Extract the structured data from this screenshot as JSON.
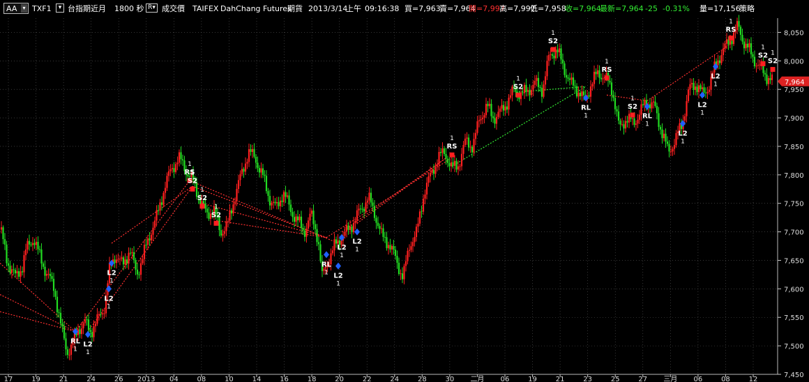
{
  "toolbar": {
    "aa_label": "AA",
    "symbol": "TXF1",
    "product_name": "台指期近月",
    "interval": "1800 秒",
    "field": "成交價",
    "exchange": "TAIFEX",
    "broker": "DahChang Futures",
    "market": "期貨",
    "date": "2013/3/14",
    "session": "上午",
    "time": "09:16:38",
    "bid": "買=7,963",
    "ask": "賣=7,964",
    "open": "開=7,997",
    "high": "高=7,997",
    "low": "低=7,958",
    "close": "收=7,964",
    "last": "最新=7,964",
    "change": "-25",
    "change_pct": "-0.31%",
    "volume": "量=17,156",
    "strategy": "策略"
  },
  "colors": {
    "background": "#000000",
    "grid": "#5a5a5a",
    "up_bar": "#ff2020",
    "down_bar": "#22dd22",
    "buy_marker": "#2060ff",
    "sell_marker": "#ff2020",
    "sell_link_line": "#ff3030",
    "buy_link_line": "#33ee33",
    "open_text": "#ff3030",
    "change_text": "#33ee33",
    "price_tag": "#dd2222"
  },
  "chart_data": {
    "type": "candlestick",
    "ylim": [
      7450,
      8075
    ],
    "y_ticks": [
      7450,
      7500,
      7550,
      7600,
      7650,
      7700,
      7750,
      7800,
      7850,
      7900,
      7950,
      8000,
      8050
    ],
    "y_tick_labels": [
      "7,450",
      "7,500",
      "7,550",
      "7,600",
      "7,650",
      "7,700",
      "7,750",
      "7,800",
      "7,850",
      "7,900",
      "7,950",
      "8,000",
      "8,050"
    ],
    "x_tick_labels": [
      "17",
      "19",
      "21",
      "24",
      "26",
      "2013",
      "04",
      "08",
      "10",
      "14",
      "16",
      "18",
      "20",
      "22",
      "24",
      "28",
      "30",
      "二月",
      "06",
      "19",
      "21",
      "23",
      "25",
      "27",
      "三月",
      "06",
      "08",
      "12"
    ],
    "current_price": 7964,
    "current_price_label": "7,964",
    "path": [
      [
        0,
        7710
      ],
      [
        10,
        7650
      ],
      [
        22,
        7620
      ],
      [
        32,
        7640
      ],
      [
        38,
        7670
      ],
      [
        48,
        7690
      ],
      [
        56,
        7660
      ],
      [
        66,
        7630
      ],
      [
        78,
        7600
      ],
      [
        88,
        7530
      ],
      [
        96,
        7490
      ],
      [
        104,
        7500
      ],
      [
        112,
        7530
      ],
      [
        122,
        7540
      ],
      [
        130,
        7525
      ],
      [
        140,
        7545
      ],
      [
        150,
        7570
      ],
      [
        158,
        7640
      ],
      [
        166,
        7660
      ],
      [
        176,
        7640
      ],
      [
        186,
        7670
      ],
      [
        196,
        7625
      ],
      [
        206,
        7660
      ],
      [
        216,
        7700
      ],
      [
        226,
        7730
      ],
      [
        236,
        7780
      ],
      [
        246,
        7810
      ],
      [
        256,
        7830
      ],
      [
        266,
        7810
      ],
      [
        276,
        7790
      ],
      [
        286,
        7760
      ],
      [
        296,
        7730
      ],
      [
        306,
        7740
      ],
      [
        316,
        7700
      ],
      [
        326,
        7710
      ],
      [
        336,
        7760
      ],
      [
        346,
        7800
      ],
      [
        356,
        7840
      ],
      [
        366,
        7830
      ],
      [
        376,
        7800
      ],
      [
        386,
        7760
      ],
      [
        396,
        7740
      ],
      [
        406,
        7770
      ],
      [
        416,
        7740
      ],
      [
        426,
        7720
      ],
      [
        436,
        7700
      ],
      [
        446,
        7730
      ],
      [
        456,
        7690
      ],
      [
        462,
        7620
      ],
      [
        470,
        7650
      ],
      [
        478,
        7670
      ],
      [
        488,
        7690
      ],
      [
        498,
        7700
      ],
      [
        508,
        7720
      ],
      [
        518,
        7740
      ],
      [
        528,
        7760
      ],
      [
        538,
        7730
      ],
      [
        548,
        7690
      ],
      [
        558,
        7680
      ],
      [
        568,
        7650
      ],
      [
        578,
        7620
      ],
      [
        588,
        7680
      ],
      [
        598,
        7700
      ],
      [
        608,
        7770
      ],
      [
        618,
        7800
      ],
      [
        628,
        7830
      ],
      [
        638,
        7840
      ],
      [
        648,
        7810
      ],
      [
        658,
        7820
      ],
      [
        668,
        7860
      ],
      [
        678,
        7850
      ],
      [
        688,
        7900
      ],
      [
        698,
        7920
      ],
      [
        708,
        7900
      ],
      [
        718,
        7910
      ],
      [
        728,
        7930
      ],
      [
        738,
        7950
      ],
      [
        748,
        7940
      ],
      [
        758,
        7950
      ],
      [
        768,
        7960
      ],
      [
        778,
        7950
      ],
      [
        788,
        8010
      ],
      [
        798,
        8020
      ],
      [
        808,
        7990
      ],
      [
        818,
        7960
      ],
      [
        828,
        7950
      ],
      [
        838,
        7930
      ],
      [
        848,
        7960
      ],
      [
        858,
        7980
      ],
      [
        868,
        7970
      ],
      [
        878,
        7950
      ],
      [
        888,
        7880
      ],
      [
        898,
        7900
      ],
      [
        908,
        7890
      ],
      [
        918,
        7910
      ],
      [
        928,
        7930
      ],
      [
        938,
        7920
      ],
      [
        948,
        7880
      ],
      [
        958,
        7840
      ],
      [
        968,
        7860
      ],
      [
        978,
        7890
      ],
      [
        988,
        7950
      ],
      [
        998,
        7960
      ],
      [
        1008,
        7940
      ],
      [
        1018,
        7960
      ],
      [
        1028,
        8000
      ],
      [
        1038,
        8020
      ],
      [
        1048,
        8040
      ],
      [
        1058,
        8060
      ],
      [
        1068,
        8030
      ],
      [
        1078,
        8010
      ],
      [
        1088,
        7990
      ],
      [
        1098,
        7975
      ],
      [
        1108,
        7964
      ]
    ],
    "signals": [
      {
        "label": "RL",
        "count": "1",
        "side": "buy",
        "x": 108,
        "price": 7525
      },
      {
        "label": "L2",
        "count": "1",
        "side": "buy",
        "x": 126,
        "price": 7520
      },
      {
        "label": "L2",
        "count": "1",
        "side": "buy",
        "x": 156,
        "price": 7600
      },
      {
        "label": "L2",
        "count": "1",
        "side": "buy",
        "x": 160,
        "price": 7645
      },
      {
        "label": "RS",
        "count": "1",
        "side": "sell",
        "x": 272,
        "price": 7790
      },
      {
        "label": "S2",
        "count": "1",
        "side": "sell",
        "x": 276,
        "price": 7775
      },
      {
        "label": "S2",
        "count": "1",
        "side": "sell",
        "x": 290,
        "price": 7745
      },
      {
        "label": "S2",
        "count": "1",
        "side": "sell",
        "x": 310,
        "price": 7715
      },
      {
        "label": "RL",
        "count": "1",
        "side": "buy",
        "x": 468,
        "price": 7660
      },
      {
        "label": "L2",
        "count": "1",
        "side": "buy",
        "x": 485,
        "price": 7640
      },
      {
        "label": "L2",
        "count": "1",
        "side": "buy",
        "x": 490,
        "price": 7690
      },
      {
        "label": "L2",
        "count": "1",
        "side": "buy",
        "x": 512,
        "price": 7700
      },
      {
        "label": "RS",
        "count": "1",
        "side": "sell",
        "x": 648,
        "price": 7835
      },
      {
        "label": "S2",
        "count": "1",
        "side": "sell",
        "x": 743,
        "price": 7940
      },
      {
        "label": "S2",
        "count": "1",
        "side": "sell",
        "x": 793,
        "price": 8020
      },
      {
        "label": "RL",
        "count": "1",
        "side": "buy",
        "x": 840,
        "price": 7935
      },
      {
        "label": "RS",
        "count": "1",
        "side": "sell",
        "x": 870,
        "price": 7970
      },
      {
        "label": "S2",
        "count": "1",
        "side": "sell",
        "x": 907,
        "price": 7905
      },
      {
        "label": "RL",
        "count": "1",
        "side": "buy",
        "x": 928,
        "price": 7920
      },
      {
        "label": "L2",
        "count": "1",
        "side": "buy",
        "x": 979,
        "price": 7890
      },
      {
        "label": "L2",
        "count": "1",
        "side": "buy",
        "x": 1007,
        "price": 7940
      },
      {
        "label": "L2",
        "count": "1",
        "side": "buy",
        "x": 1026,
        "price": 7990
      },
      {
        "label": "RS",
        "count": "1",
        "side": "sell",
        "x": 1048,
        "price": 8040
      },
      {
        "label": "S2",
        "count": "1",
        "side": "sell",
        "x": 1094,
        "price": 7995
      },
      {
        "label": "S2",
        "count": "1",
        "side": "sell",
        "x": 1108,
        "price": 7985
      }
    ],
    "sell_link_lines": [
      [
        [
          0,
          7645
        ],
        [
          108,
          7525
        ]
      ],
      [
        [
          0,
          7590
        ],
        [
          108,
          7525
        ]
      ],
      [
        [
          0,
          7560
        ],
        [
          108,
          7525
        ]
      ],
      [
        [
          108,
          7525
        ],
        [
          272,
          7790
        ]
      ],
      [
        [
          126,
          7525
        ],
        [
          276,
          7780
        ]
      ],
      [
        [
          160,
          7680
        ],
        [
          276,
          7780
        ]
      ],
      [
        [
          276,
          7780
        ],
        [
          468,
          7690
        ]
      ],
      [
        [
          290,
          7750
        ],
        [
          468,
          7690
        ]
      ],
      [
        [
          310,
          7720
        ],
        [
          468,
          7690
        ]
      ],
      [
        [
          272,
          7790
        ],
        [
          485,
          7680
        ]
      ],
      [
        [
          468,
          7690
        ],
        [
          648,
          7830
        ]
      ],
      [
        [
          490,
          7700
        ],
        [
          640,
          7830
        ]
      ],
      [
        [
          512,
          7715
        ],
        [
          640,
          7830
        ]
      ],
      [
        [
          870,
          7940
        ],
        [
          928,
          7930
        ]
      ],
      [
        [
          928,
          7930
        ],
        [
          1048,
          8030
        ]
      ]
    ],
    "buy_link_lines": [
      [
        [
          648,
          7815
        ],
        [
          840,
          7955
        ]
      ],
      [
        [
          740,
          7945
        ],
        [
          840,
          7955
        ]
      ]
    ]
  }
}
